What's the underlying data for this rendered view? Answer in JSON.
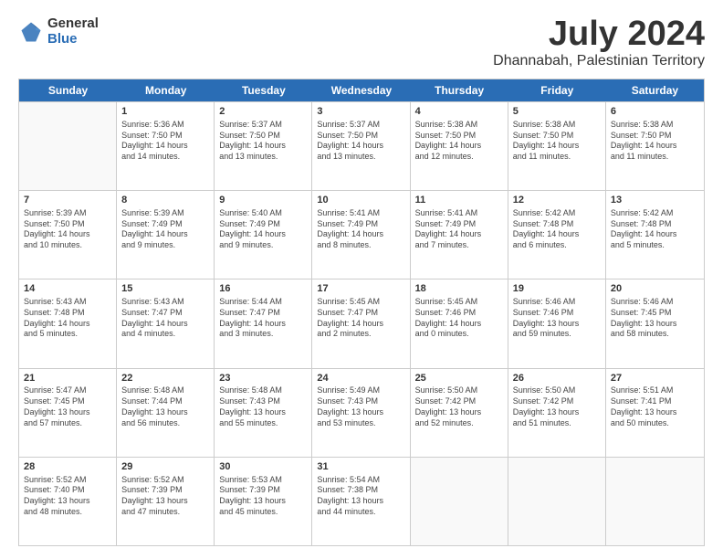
{
  "header": {
    "logo_general": "General",
    "logo_blue": "Blue",
    "month": "July 2024",
    "location": "Dhannabah, Palestinian Territory"
  },
  "days_of_week": [
    "Sunday",
    "Monday",
    "Tuesday",
    "Wednesday",
    "Thursday",
    "Friday",
    "Saturday"
  ],
  "weeks": [
    [
      {
        "day": "",
        "info": ""
      },
      {
        "day": "1",
        "info": "Sunrise: 5:36 AM\nSunset: 7:50 PM\nDaylight: 14 hours\nand 14 minutes."
      },
      {
        "day": "2",
        "info": "Sunrise: 5:37 AM\nSunset: 7:50 PM\nDaylight: 14 hours\nand 13 minutes."
      },
      {
        "day": "3",
        "info": "Sunrise: 5:37 AM\nSunset: 7:50 PM\nDaylight: 14 hours\nand 13 minutes."
      },
      {
        "day": "4",
        "info": "Sunrise: 5:38 AM\nSunset: 7:50 PM\nDaylight: 14 hours\nand 12 minutes."
      },
      {
        "day": "5",
        "info": "Sunrise: 5:38 AM\nSunset: 7:50 PM\nDaylight: 14 hours\nand 11 minutes."
      },
      {
        "day": "6",
        "info": "Sunrise: 5:38 AM\nSunset: 7:50 PM\nDaylight: 14 hours\nand 11 minutes."
      }
    ],
    [
      {
        "day": "7",
        "info": "Sunrise: 5:39 AM\nSunset: 7:50 PM\nDaylight: 14 hours\nand 10 minutes."
      },
      {
        "day": "8",
        "info": "Sunrise: 5:39 AM\nSunset: 7:49 PM\nDaylight: 14 hours\nand 9 minutes."
      },
      {
        "day": "9",
        "info": "Sunrise: 5:40 AM\nSunset: 7:49 PM\nDaylight: 14 hours\nand 9 minutes."
      },
      {
        "day": "10",
        "info": "Sunrise: 5:41 AM\nSunset: 7:49 PM\nDaylight: 14 hours\nand 8 minutes."
      },
      {
        "day": "11",
        "info": "Sunrise: 5:41 AM\nSunset: 7:49 PM\nDaylight: 14 hours\nand 7 minutes."
      },
      {
        "day": "12",
        "info": "Sunrise: 5:42 AM\nSunset: 7:48 PM\nDaylight: 14 hours\nand 6 minutes."
      },
      {
        "day": "13",
        "info": "Sunrise: 5:42 AM\nSunset: 7:48 PM\nDaylight: 14 hours\nand 5 minutes."
      }
    ],
    [
      {
        "day": "14",
        "info": "Sunrise: 5:43 AM\nSunset: 7:48 PM\nDaylight: 14 hours\nand 5 minutes."
      },
      {
        "day": "15",
        "info": "Sunrise: 5:43 AM\nSunset: 7:47 PM\nDaylight: 14 hours\nand 4 minutes."
      },
      {
        "day": "16",
        "info": "Sunrise: 5:44 AM\nSunset: 7:47 PM\nDaylight: 14 hours\nand 3 minutes."
      },
      {
        "day": "17",
        "info": "Sunrise: 5:45 AM\nSunset: 7:47 PM\nDaylight: 14 hours\nand 2 minutes."
      },
      {
        "day": "18",
        "info": "Sunrise: 5:45 AM\nSunset: 7:46 PM\nDaylight: 14 hours\nand 0 minutes."
      },
      {
        "day": "19",
        "info": "Sunrise: 5:46 AM\nSunset: 7:46 PM\nDaylight: 13 hours\nand 59 minutes."
      },
      {
        "day": "20",
        "info": "Sunrise: 5:46 AM\nSunset: 7:45 PM\nDaylight: 13 hours\nand 58 minutes."
      }
    ],
    [
      {
        "day": "21",
        "info": "Sunrise: 5:47 AM\nSunset: 7:45 PM\nDaylight: 13 hours\nand 57 minutes."
      },
      {
        "day": "22",
        "info": "Sunrise: 5:48 AM\nSunset: 7:44 PM\nDaylight: 13 hours\nand 56 minutes."
      },
      {
        "day": "23",
        "info": "Sunrise: 5:48 AM\nSunset: 7:43 PM\nDaylight: 13 hours\nand 55 minutes."
      },
      {
        "day": "24",
        "info": "Sunrise: 5:49 AM\nSunset: 7:43 PM\nDaylight: 13 hours\nand 53 minutes."
      },
      {
        "day": "25",
        "info": "Sunrise: 5:50 AM\nSunset: 7:42 PM\nDaylight: 13 hours\nand 52 minutes."
      },
      {
        "day": "26",
        "info": "Sunrise: 5:50 AM\nSunset: 7:42 PM\nDaylight: 13 hours\nand 51 minutes."
      },
      {
        "day": "27",
        "info": "Sunrise: 5:51 AM\nSunset: 7:41 PM\nDaylight: 13 hours\nand 50 minutes."
      }
    ],
    [
      {
        "day": "28",
        "info": "Sunrise: 5:52 AM\nSunset: 7:40 PM\nDaylight: 13 hours\nand 48 minutes."
      },
      {
        "day": "29",
        "info": "Sunrise: 5:52 AM\nSunset: 7:39 PM\nDaylight: 13 hours\nand 47 minutes."
      },
      {
        "day": "30",
        "info": "Sunrise: 5:53 AM\nSunset: 7:39 PM\nDaylight: 13 hours\nand 45 minutes."
      },
      {
        "day": "31",
        "info": "Sunrise: 5:54 AM\nSunset: 7:38 PM\nDaylight: 13 hours\nand 44 minutes."
      },
      {
        "day": "",
        "info": ""
      },
      {
        "day": "",
        "info": ""
      },
      {
        "day": "",
        "info": ""
      }
    ]
  ]
}
